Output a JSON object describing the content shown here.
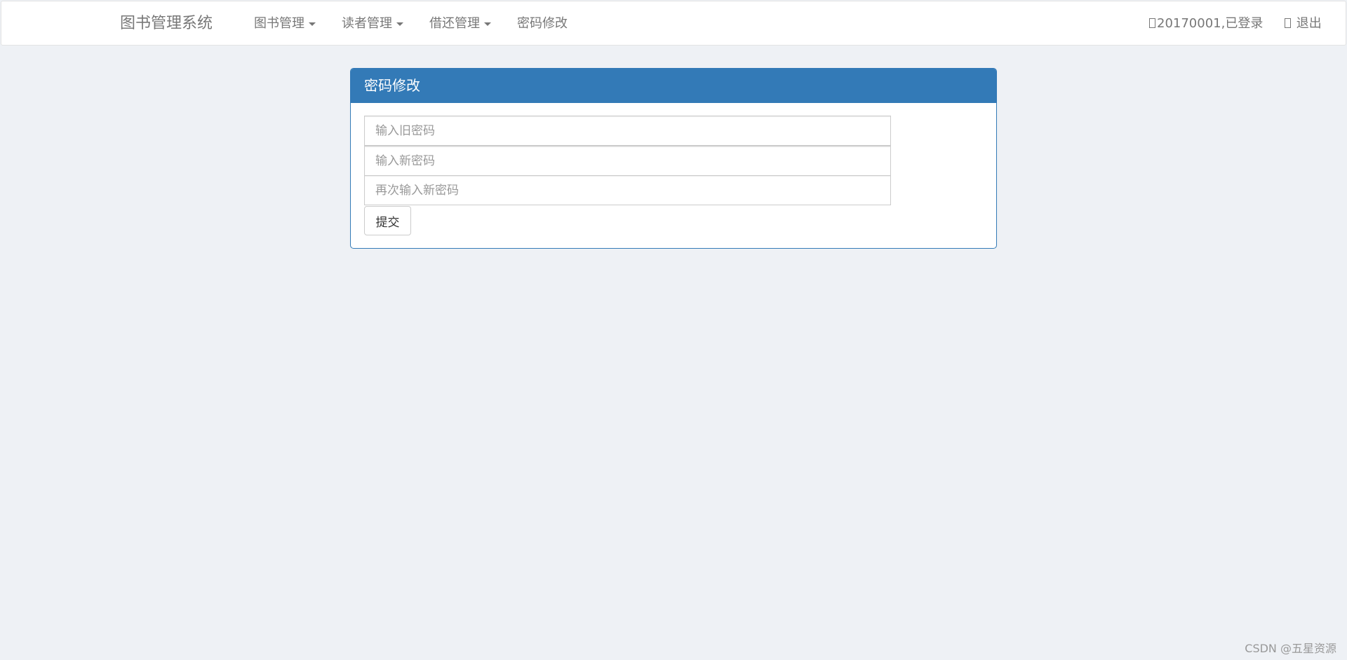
{
  "navbar": {
    "brand": "图书管理系统",
    "menu": [
      {
        "label": "图书管理",
        "dropdown": true
      },
      {
        "label": "读者管理",
        "dropdown": true
      },
      {
        "label": "借还管理",
        "dropdown": true
      },
      {
        "label": "密码修改",
        "dropdown": false
      }
    ],
    "user_status": "20170001,已登录",
    "logout": "退出"
  },
  "panel": {
    "title": "密码修改",
    "old_password_placeholder": "输入旧密码",
    "new_password_placeholder": "输入新密码",
    "confirm_password_placeholder": "再次输入新密码",
    "submit_label": "提交"
  },
  "watermark": "CSDN @五星资源",
  "colors": {
    "primary": "#337ab7",
    "background": "#eef1f5"
  }
}
